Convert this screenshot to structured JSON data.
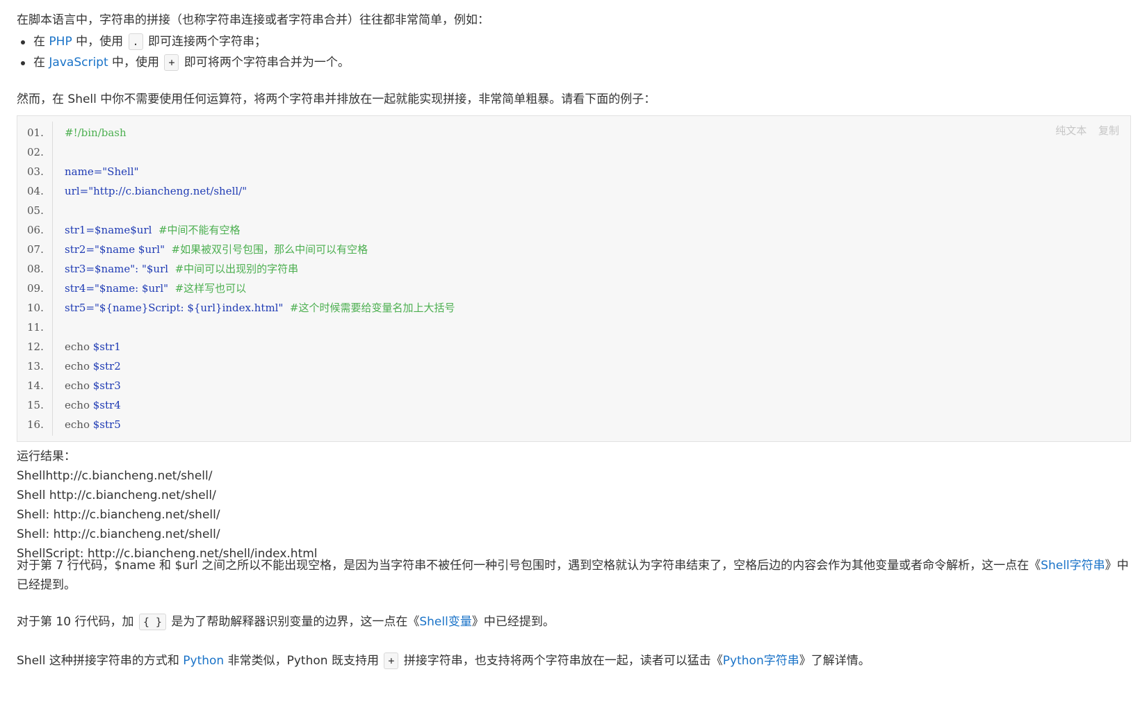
{
  "intro": {
    "text": "在脚本语言中，字符串的拼接（也称字符串连接或者字符串合并）往往都非常简单，例如：",
    "bullets": [
      {
        "prefix": "在 ",
        "link": "PHP",
        "mid": " 中，使用 ",
        "op": ".",
        "suffix": " 即可连接两个字符串；"
      },
      {
        "prefix": "在 ",
        "link": "JavaScript",
        "mid": " 中，使用 ",
        "op": "+",
        "suffix": " 即可将两个字符串合并为一个。"
      }
    ]
  },
  "shell_intro": "然而，在 Shell 中你不需要使用任何运算符，将两个字符串并排放在一起就能实现拼接，非常简单粗暴。请看下面的例子：",
  "code_toolbar": {
    "plain_text": "纯文本",
    "copy": "复制"
  },
  "code_lines": [
    {
      "n": "01.",
      "parts": [
        {
          "t": "#!/bin/bash",
          "c": "com"
        }
      ]
    },
    {
      "n": "02.",
      "parts": []
    },
    {
      "n": "03.",
      "parts": [
        {
          "t": "name=\"Shell\"",
          "c": "var"
        }
      ]
    },
    {
      "n": "04.",
      "parts": [
        {
          "t": "url=\"http://c.biancheng.net/shell/\"",
          "c": "var"
        }
      ]
    },
    {
      "n": "05.",
      "parts": []
    },
    {
      "n": "06.",
      "parts": [
        {
          "t": "str1=$name$url",
          "c": "var"
        },
        {
          "t": "  #中间不能有空格",
          "c": "com"
        }
      ]
    },
    {
      "n": "07.",
      "parts": [
        {
          "t": "str2=\"$name $url\"",
          "c": "var"
        },
        {
          "t": "  #如果被双引号包围，那么中间可以有空格",
          "c": "com"
        }
      ]
    },
    {
      "n": "08.",
      "parts": [
        {
          "t": "str3=$name\": \"$url",
          "c": "var"
        },
        {
          "t": "  #中间可以出现别的字符串",
          "c": "com"
        }
      ]
    },
    {
      "n": "09.",
      "parts": [
        {
          "t": "str4=\"$name: $url\"",
          "c": "var"
        },
        {
          "t": "  #这样写也可以",
          "c": "com"
        }
      ]
    },
    {
      "n": "10.",
      "parts": [
        {
          "t": "str5=\"${name}Script: ${url}index.html\"",
          "c": "var"
        },
        {
          "t": "  #这个时候需要给变量名加上大括号",
          "c": "com"
        }
      ]
    },
    {
      "n": "11.",
      "parts": []
    },
    {
      "n": "12.",
      "parts": [
        {
          "t": "echo ",
          "c": "kw"
        },
        {
          "t": "$str1",
          "c": "var"
        }
      ]
    },
    {
      "n": "13.",
      "parts": [
        {
          "t": "echo ",
          "c": "kw"
        },
        {
          "t": "$str2",
          "c": "var"
        }
      ]
    },
    {
      "n": "14.",
      "parts": [
        {
          "t": "echo ",
          "c": "kw"
        },
        {
          "t": "$str3",
          "c": "var"
        }
      ]
    },
    {
      "n": "15.",
      "parts": [
        {
          "t": "echo ",
          "c": "kw"
        },
        {
          "t": "$str4",
          "c": "var"
        }
      ]
    },
    {
      "n": "16.",
      "parts": [
        {
          "t": "echo ",
          "c": "kw"
        },
        {
          "t": "$str5",
          "c": "var"
        }
      ]
    }
  ],
  "results": {
    "label": "运行结果：",
    "lines": [
      "Shellhttp://c.biancheng.net/shell/",
      "Shell http://c.biancheng.net/shell/",
      "Shell: http://c.biancheng.net/shell/",
      "Shell: http://c.biancheng.net/shell/",
      "ShellScript: http://c.biancheng.net/shell/index.html"
    ]
  },
  "para1": {
    "text": "对于第 7 行代码，$name 和 $url 之间之所以不能出现空格，是因为当字符串不被任何一种引号包围时，遇到空格就认为字符串结束了，空格后边的内容会作为其他变量或者命令解析，这一点在《",
    "link": "Shell字符串",
    "suffix": "》中已经提到。"
  },
  "para2": {
    "prefix": "对于第 10 行代码，加 ",
    "op": "{ }",
    "mid": " 是为了帮助解释器识别变量的边界，这一点在《",
    "link": "Shell变量",
    "suffix": "》中已经提到。"
  },
  "para3": {
    "prefix": "Shell 这种拼接字符串的方式和 ",
    "link1": "Python",
    "mid1": " 非常类似，Python 既支持用 ",
    "op": "+",
    "mid2": " 拼接字符串，也支持将两个字符串放在一起，读者可以猛击《",
    "link2": "Python字符串",
    "suffix": "》了解详情。"
  },
  "colors": {
    "link": "#1a73c8",
    "comment": "#4caf50",
    "variable": "#1f3bb4",
    "code_bg": "#f7f7f7"
  }
}
